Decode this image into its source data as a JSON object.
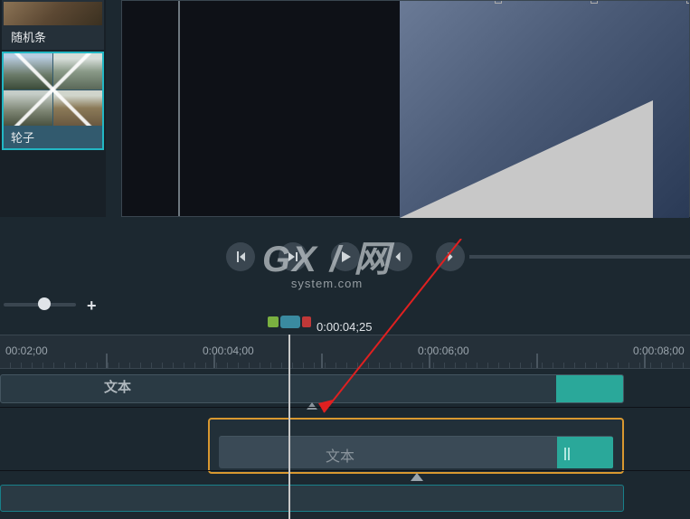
{
  "media_library": {
    "items": [
      {
        "label": "随机条",
        "selected": false
      },
      {
        "label": "轮子",
        "selected": true
      }
    ]
  },
  "playhead": {
    "time_display": "0:00:04;25"
  },
  "ruler": {
    "labels": [
      "00:02;00",
      "0:00:04;00",
      "0:00:06;00",
      "0:00:08;00"
    ]
  },
  "tracks": {
    "top_clip_label": "文本",
    "selected_clip_label": "文本"
  },
  "zoom": {
    "plus_glyph": "+"
  },
  "watermark": {
    "brand": "GX / 网",
    "sub": "system.com"
  },
  "icons": {
    "prev_frame": "prev-frame",
    "step_back": "step-back",
    "play": "play",
    "prev_marker": "prev-marker",
    "next_marker": "next-marker"
  }
}
